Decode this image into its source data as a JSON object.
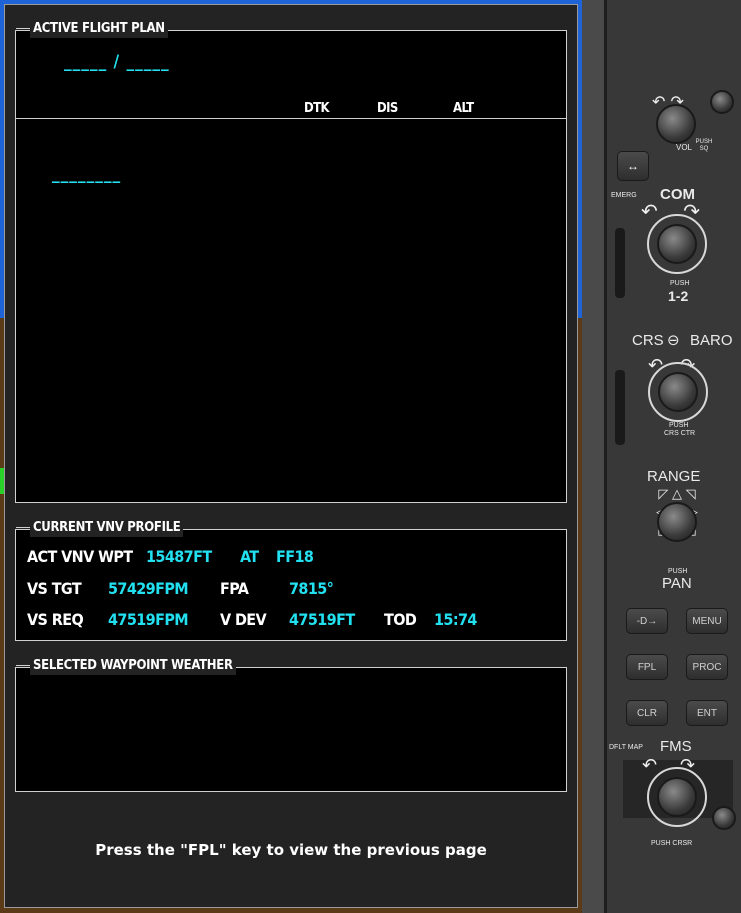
{
  "active_flight_plan": {
    "title": "ACTIVE FLIGHT PLAN",
    "route_placeholder": "_____ / _____",
    "columns": {
      "dtk": "DTK",
      "dis": "DIS",
      "alt": "ALT"
    },
    "waypoint_placeholder": "________"
  },
  "vnv_profile": {
    "title": "CURRENT VNV PROFILE",
    "row1": {
      "label": "ACT VNV WPT",
      "alt_value": "15487FT",
      "at_label": "AT",
      "waypoint": "FF18"
    },
    "row2": {
      "vs_tgt_label": "VS TGT",
      "vs_tgt_value": "57429FPM",
      "fpa_label": "FPA",
      "fpa_value": "7815°"
    },
    "row3": {
      "vs_req_label": "VS REQ",
      "vs_req_value": "47519FPM",
      "vdev_label": "V DEV",
      "vdev_value": "47519FT",
      "tod_label": "TOD",
      "tod_value": "15:74"
    }
  },
  "waypoint_weather": {
    "title": "SELECTED WAYPOINT WEATHER"
  },
  "footer_hint": "Press the \"FPL\" key to view the previous page",
  "bezel": {
    "vol_label": "VOL",
    "vol_push_label": "PUSH SQ",
    "emerg_label": "EMERG",
    "com_label": "COM",
    "com_push_label": "PUSH",
    "com_12_label": "1-2",
    "crs_label": "CRS",
    "baro_label": "BARO",
    "crs_push_label": "PUSH",
    "crs_ctr_label": "CRS CTR",
    "range_label": "RANGE",
    "pan_push_label": "PUSH",
    "pan_label": "PAN",
    "menu_label": "MENU",
    "fpl_label": "FPL",
    "proc_label": "PROC",
    "clr_label": "CLR",
    "ent_label": "ENT",
    "dflt_map_label": "DFLT MAP",
    "fms_label": "FMS",
    "push_crsr_label": "PUSH CRSR"
  },
  "colors": {
    "cyan_value": "#22e0f0",
    "panel_bg": "#000000",
    "dialog_bg": "#232323"
  }
}
